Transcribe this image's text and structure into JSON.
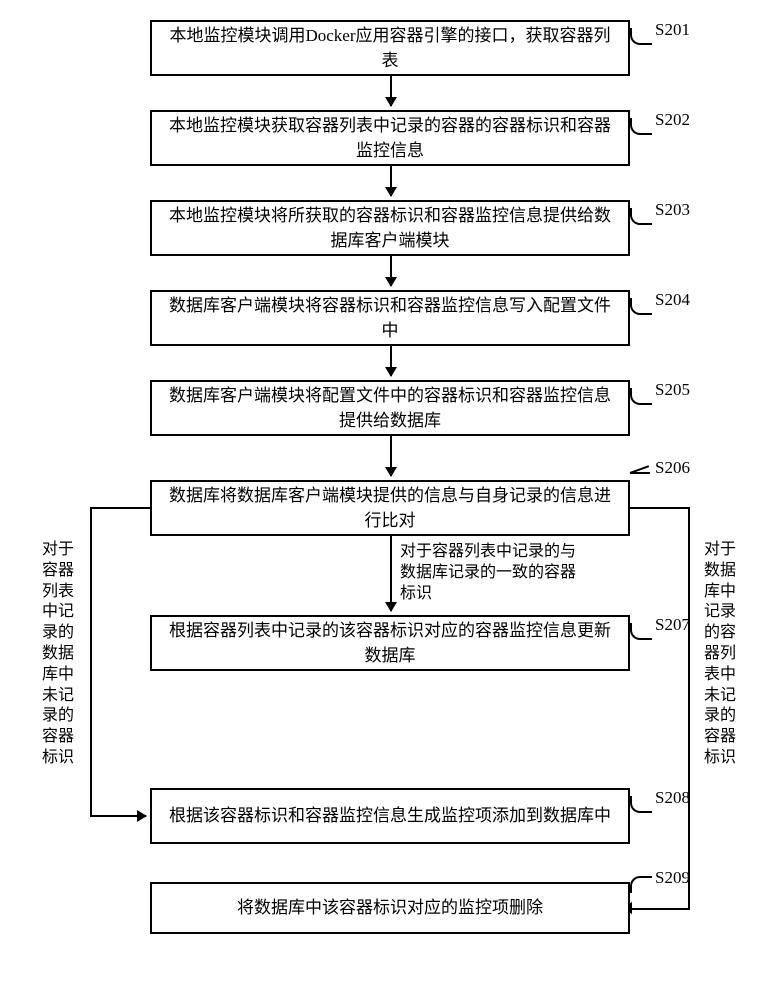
{
  "steps": [
    {
      "id": "S201",
      "text": "本地监控模块调用Docker应用容器引擎的接口，获取容器列表"
    },
    {
      "id": "S202",
      "text": "本地监控模块获取容器列表中记录的容器的容器标识和容器监控信息"
    },
    {
      "id": "S203",
      "text": "本地监控模块将所获取的容器标识和容器监控信息提供给数据库客户端模块"
    },
    {
      "id": "S204",
      "text": "数据库客户端模块将容器标识和容器监控信息写入配置文件中"
    },
    {
      "id": "S205",
      "text": "数据库客户端模块将配置文件中的容器标识和容器监控信息提供给数据库"
    },
    {
      "id": "S206",
      "text": "数据库将数据库客户端模块提供的信息与自身记录的信息进行比对"
    },
    {
      "id": "S207",
      "text": "根据容器列表中记录的该容器标识对应的容器监控信息更新数据库"
    },
    {
      "id": "S208",
      "text": "根据该容器标识和容器监控信息生成监控项添加到数据库中"
    },
    {
      "id": "S209",
      "text": "将数据库中该容器标识对应的监控项删除"
    }
  ],
  "edge_labels": {
    "left": "对于容器列表中记录的数据库中未记录的容器标识",
    "right": "对于数据库中记录的容器列表中未记录的容器标识",
    "mid": "对于容器列表中记录的与数据库记录的一致的容器标识"
  }
}
